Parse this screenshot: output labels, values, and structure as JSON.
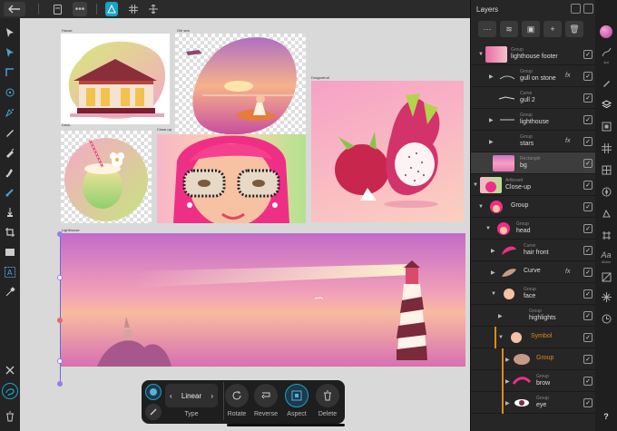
{
  "toolbar": {
    "back_icon": "arrow-left-icon",
    "document_icon": "document-icon",
    "more_icon": "ellipsis-icon",
    "persona_icon": "designer-persona-icon",
    "grid_icon": "grid-icon",
    "move_icon": "move-icon"
  },
  "tools": [
    "move-tool-icon",
    "node-tool-icon",
    "corner-tool-icon",
    "point-transform-icon",
    "pen-tool-icon",
    "pencil-tool-icon",
    "vector-brush-icon",
    "fill-tool-icon",
    "transparency-tool-icon",
    "place-image-icon",
    "crop-tool-icon",
    "rectangle-tool-icon",
    "artistic-text-icon",
    "color-picker-icon",
    "close-icon",
    "lasso-icon",
    "trash-icon"
  ],
  "canvas": {
    "artboards": {
      "house": "House",
      "girl_sea": "Girl sea",
      "dragonfruit": "Dragonfruit",
      "drink": "Drink",
      "closeup": "Close-up",
      "lighthouse": "Lighthouse"
    }
  },
  "context_bar": {
    "fill_type": "Linear",
    "type_label": "Type",
    "rotate_label": "Rotate",
    "reverse_label": "Reverse",
    "aspect_label": "Aspect",
    "delete_label": "Delete"
  },
  "layers_panel": {
    "title": "Layers",
    "rows": [
      {
        "type": "Group",
        "name": "lighthouse footer",
        "fx": "",
        "checked": true
      },
      {
        "type": "Group",
        "name": "gull on stone",
        "fx": "fx",
        "checked": true
      },
      {
        "type": "Curve",
        "name": "gull 2",
        "fx": "",
        "checked": true
      },
      {
        "type": "Group",
        "name": "lighthouse",
        "fx": "",
        "checked": true
      },
      {
        "type": "Group",
        "name": "stars",
        "fx": "fx",
        "checked": true
      },
      {
        "type": "Rectangle",
        "name": "bg",
        "fx": "",
        "checked": true
      },
      {
        "type": "Artboard",
        "name": "Close-up",
        "fx": "",
        "checked": true
      },
      {
        "type": "",
        "name": "Group",
        "fx": "",
        "checked": true
      },
      {
        "type": "Group",
        "name": "head",
        "fx": "",
        "checked": true
      },
      {
        "type": "Curve",
        "name": "hair front",
        "fx": "",
        "checked": true
      },
      {
        "type": "",
        "name": "Curve",
        "fx": "fx",
        "checked": true
      },
      {
        "type": "Group",
        "name": "face",
        "fx": "",
        "checked": true
      },
      {
        "type": "Group",
        "name": "highlights",
        "fx": "",
        "checked": true
      },
      {
        "type": "",
        "name": "Symbol",
        "fx": "",
        "checked": true
      },
      {
        "type": "",
        "name": "Group",
        "fx": "",
        "checked": true
      },
      {
        "type": "Group",
        "name": "brow",
        "fx": "",
        "checked": true
      },
      {
        "type": "Group",
        "name": "eye",
        "fx": "",
        "checked": true
      }
    ]
  },
  "studio": {
    "brush_size": "4pt",
    "text_label": "Aa",
    "text_label2": "Ablon"
  },
  "colors": {
    "accent": "#1aa3c8",
    "symbol_orange": "#e08a18",
    "panel_bg": "#262626",
    "canvas_bg": "#d9d9d9"
  }
}
